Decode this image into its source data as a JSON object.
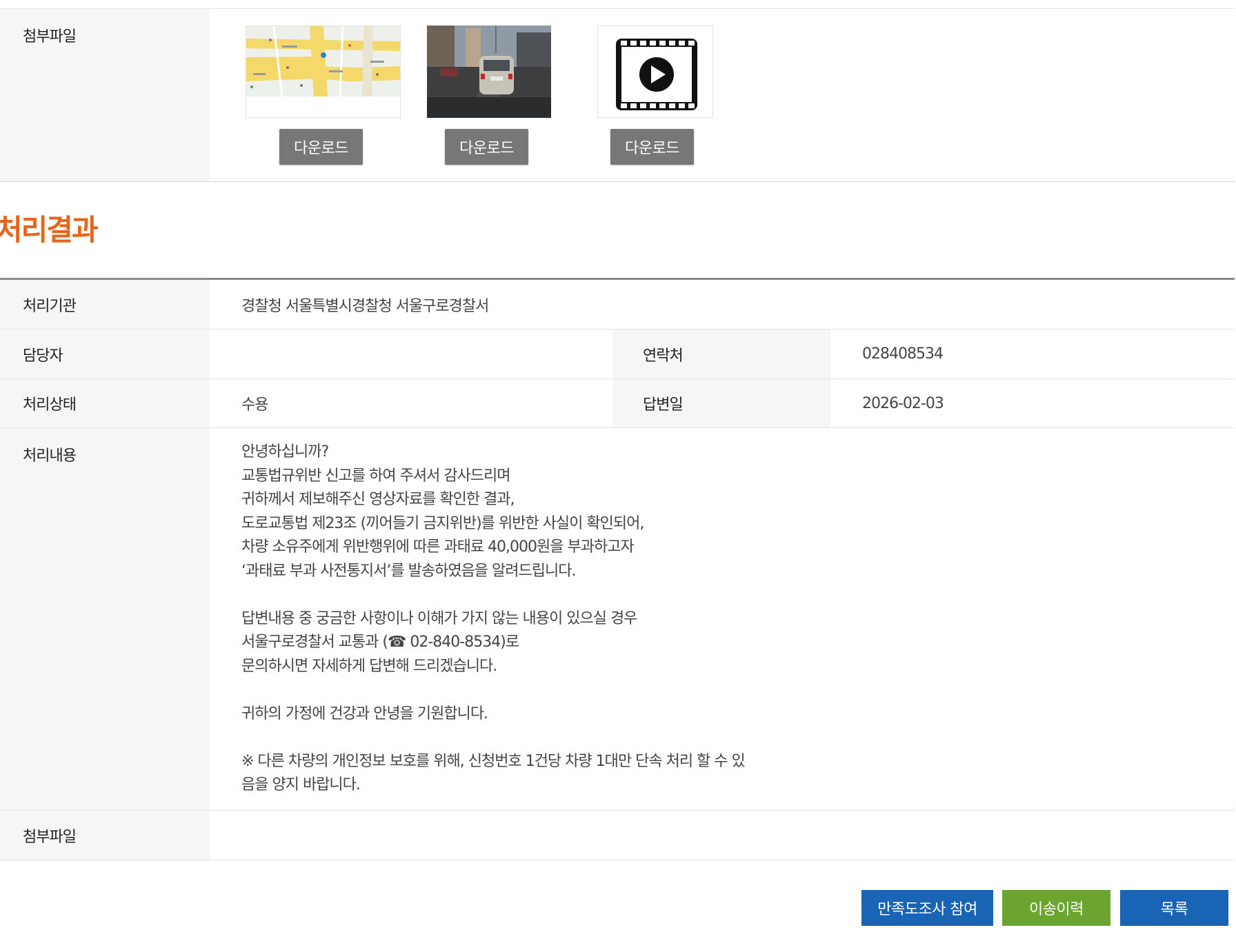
{
  "attachments_top": {
    "label": "첨부파일",
    "files": [
      {
        "kind": "map-thumbnail",
        "download_label": "다운로드"
      },
      {
        "kind": "road-photo-thumbnail",
        "download_label": "다운로드"
      },
      {
        "kind": "video-file-icon",
        "download_label": "다운로드"
      }
    ]
  },
  "result_section": {
    "title": "처리결과",
    "agency_label": "처리기관",
    "agency_value": "경찰청 서울특별시경찰청 서울구로경찰서",
    "person_label": "담당자",
    "person_value": "",
    "contact_label": "연락처",
    "contact_value": "028408534",
    "status_label": "처리상태",
    "status_value": "수용",
    "answer_date_label": "답변일",
    "answer_date_value": "2026-02-03",
    "content_label": "처리내용",
    "content_lines": [
      "안녕하십니까?",
      "교통법규위반 신고를 하여 주셔서 감사드리며",
      "귀하께서 제보해주신 영상자료를 확인한 결과,",
      "도로교통법 제23조 (끼어들기 금지위반)를 위반한 사실이 확인되어,",
      "차량 소유주에게 위반행위에 따른 과태료 40,000원을 부과하고자",
      "‘과태료 부과 사전통지서’를 발송하였음을 알려드립니다.",
      "",
      "답변내용 중 궁금한 사항이나 이해가 가지 않는 내용이 있으실 경우",
      "서울구로경찰서 교통과 (☎ 02-840-8534)로",
      "문의하시면 자세하게 답변해 드리겠습니다.",
      "",
      "귀하의 가정에 건강과 안녕을 기원합니다.",
      "",
      "※ 다른 차량의 개인정보 보호를 위해, 신청번호 1건당 차량 1대만 단속 처리 할 수 있",
      "음을 양지 바랍니다."
    ],
    "files_label": "첨부파일"
  },
  "buttons": {
    "survey": "만족도조사 참여",
    "history": "이송이력",
    "list": "목록"
  },
  "colors": {
    "title_orange": "#e8641b",
    "primary_blue": "#1a64b5",
    "history_green": "#6ba52f",
    "download_gray": "#777777",
    "header_cell_bg": "#f6f6f6"
  }
}
